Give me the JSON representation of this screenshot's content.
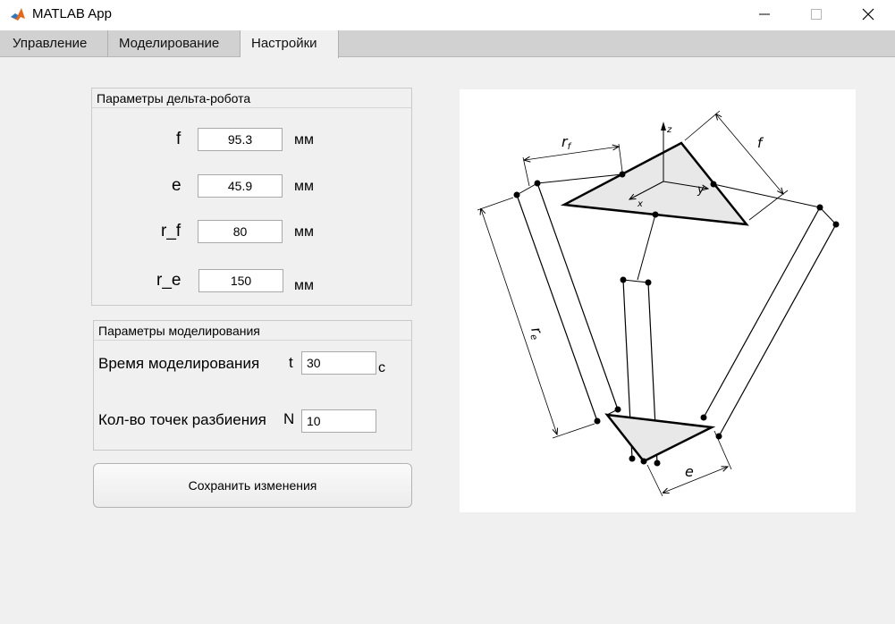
{
  "window": {
    "title": "MATLAB App"
  },
  "tabs": [
    {
      "label": "Управление"
    },
    {
      "label": "Моделирование"
    },
    {
      "label": "Настройки",
      "active": true
    }
  ],
  "robot_params": {
    "title": "Параметры дельта-робота",
    "fields": [
      {
        "label": "f",
        "value": "95.3",
        "unit": "мм"
      },
      {
        "label": "e",
        "value": "45.9",
        "unit": "мм"
      },
      {
        "label": "r_f",
        "value": "80",
        "unit": "мм"
      },
      {
        "label": "r_e",
        "value": "150",
        "unit": "мм"
      }
    ]
  },
  "sim_params": {
    "title": "Параметры моделирования",
    "time": {
      "label": "Время моделирования",
      "symbol": "t",
      "value": "30",
      "unit": "с"
    },
    "points": {
      "label": "Кол-во точек разбиения",
      "symbol": "N",
      "value": "10"
    }
  },
  "save_button": {
    "label": "Сохранить изменения"
  },
  "diagram": {
    "labels": {
      "rf": "r",
      "rf_sub": "f",
      "re": "r",
      "re_sub": "e",
      "f": "f",
      "e": "e",
      "z": "z",
      "y": "y",
      "x": "x"
    }
  },
  "colors": {
    "accent": "#d1d1d1",
    "panel_bg": "#f0f0f0",
    "figure_fill": "#e8e8e8"
  }
}
